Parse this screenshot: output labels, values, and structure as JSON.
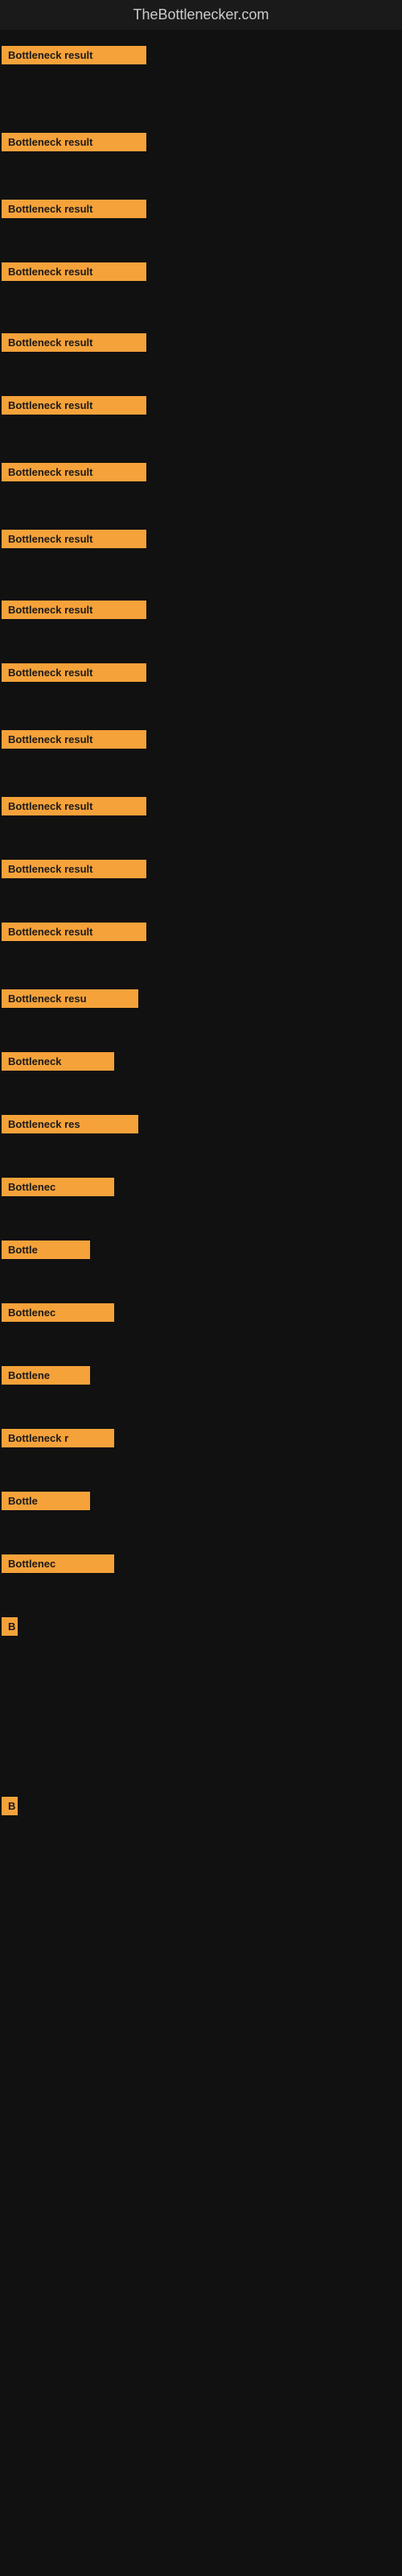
{
  "site": {
    "title": "TheBottlenecker.com"
  },
  "items": [
    {
      "id": 1,
      "label": "Bottleneck result",
      "widthClass": "w-full",
      "marginTop": 10
    },
    {
      "id": 2,
      "label": "Bottleneck result",
      "widthClass": "w-full",
      "marginTop": 85
    },
    {
      "id": 3,
      "label": "Bottleneck result",
      "widthClass": "w-full",
      "marginTop": 60
    },
    {
      "id": 4,
      "label": "Bottleneck result",
      "widthClass": "w-full",
      "marginTop": 55
    },
    {
      "id": 5,
      "label": "Bottleneck result",
      "widthClass": "w-full",
      "marginTop": 65
    },
    {
      "id": 6,
      "label": "Bottleneck result",
      "widthClass": "w-full",
      "marginTop": 55
    },
    {
      "id": 7,
      "label": "Bottleneck result",
      "widthClass": "w-full",
      "marginTop": 60
    },
    {
      "id": 8,
      "label": "Bottleneck result",
      "widthClass": "w-full",
      "marginTop": 60
    },
    {
      "id": 9,
      "label": "Bottleneck result",
      "widthClass": "w-full",
      "marginTop": 65
    },
    {
      "id": 10,
      "label": "Bottleneck result",
      "widthClass": "w-full",
      "marginTop": 55
    },
    {
      "id": 11,
      "label": "Bottleneck result",
      "widthClass": "w-full",
      "marginTop": 60
    },
    {
      "id": 12,
      "label": "Bottleneck result",
      "widthClass": "w-full",
      "marginTop": 60
    },
    {
      "id": 13,
      "label": "Bottleneck result",
      "widthClass": "w-full",
      "marginTop": 55
    },
    {
      "id": 14,
      "label": "Bottleneck result",
      "widthClass": "w-full",
      "marginTop": 55
    },
    {
      "id": 15,
      "label": "Bottleneck resu",
      "widthClass": "w-large",
      "marginTop": 60
    },
    {
      "id": 16,
      "label": "Bottleneck",
      "widthClass": "w-medium",
      "marginTop": 55
    },
    {
      "id": 17,
      "label": "Bottleneck res",
      "widthClass": "w-large",
      "marginTop": 55
    },
    {
      "id": 18,
      "label": "Bottlenec",
      "widthClass": "w-medium",
      "marginTop": 55
    },
    {
      "id": 19,
      "label": "Bottle",
      "widthClass": "w-small",
      "marginTop": 55
    },
    {
      "id": 20,
      "label": "Bottlenec",
      "widthClass": "w-medium",
      "marginTop": 55
    },
    {
      "id": 21,
      "label": "Bottlene",
      "widthClass": "w-small",
      "marginTop": 55
    },
    {
      "id": 22,
      "label": "Bottleneck r",
      "widthClass": "w-medium",
      "marginTop": 55
    },
    {
      "id": 23,
      "label": "Bottle",
      "widthClass": "w-small",
      "marginTop": 55
    },
    {
      "id": 24,
      "label": "Bottlenec",
      "widthClass": "w-medium",
      "marginTop": 55
    },
    {
      "id": 25,
      "label": "B",
      "widthClass": "w-nano",
      "marginTop": 55
    },
    {
      "id": 26,
      "label": "",
      "widthClass": "w-pico",
      "marginTop": 200
    },
    {
      "id": 27,
      "label": "",
      "widthClass": "w-pico",
      "marginTop": 200
    },
    {
      "id": 28,
      "label": "",
      "widthClass": "w-pico",
      "marginTop": 200
    },
    {
      "id": 29,
      "label": "B",
      "widthClass": "w-nano",
      "marginTop": 200
    },
    {
      "id": 30,
      "label": "",
      "widthClass": "w-pico",
      "marginTop": 200
    },
    {
      "id": 31,
      "label": "",
      "widthClass": "w-pico",
      "marginTop": 200
    },
    {
      "id": 32,
      "label": "",
      "widthClass": "w-pico",
      "marginTop": 200
    }
  ],
  "colors": {
    "background": "#111111",
    "labelBg": "#f5a23a",
    "labelText": "#1a1a1a",
    "titleText": "#cccccc"
  }
}
